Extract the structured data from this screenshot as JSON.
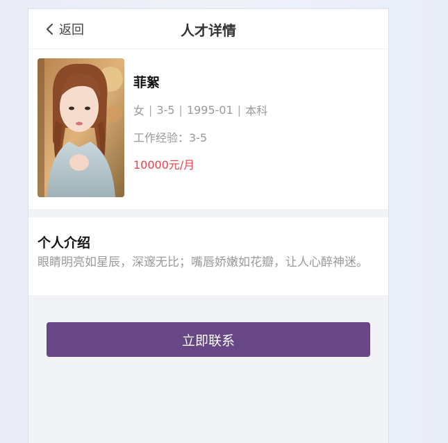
{
  "header": {
    "back_label": "返回",
    "title": "人才详情"
  },
  "profile": {
    "name": "菲絮",
    "gender": "女",
    "experience_range": "3-5",
    "birth": "1995-01",
    "education": "本科",
    "work_experience": "工作经验：3-5",
    "salary": "10000元/月",
    "photo_icon": "portrait-photo"
  },
  "intro": {
    "title": "个人介绍",
    "text": "眼睛明亮如星辰，深邃无比；嘴唇娇嫩如花瓣，让人心醉神迷。"
  },
  "actions": {
    "contact_label": "立即联系"
  },
  "colors": {
    "accent": "#674786",
    "salary": "#e8424b",
    "muted_text": "#999999",
    "page_bg": "#f2f3f6"
  }
}
